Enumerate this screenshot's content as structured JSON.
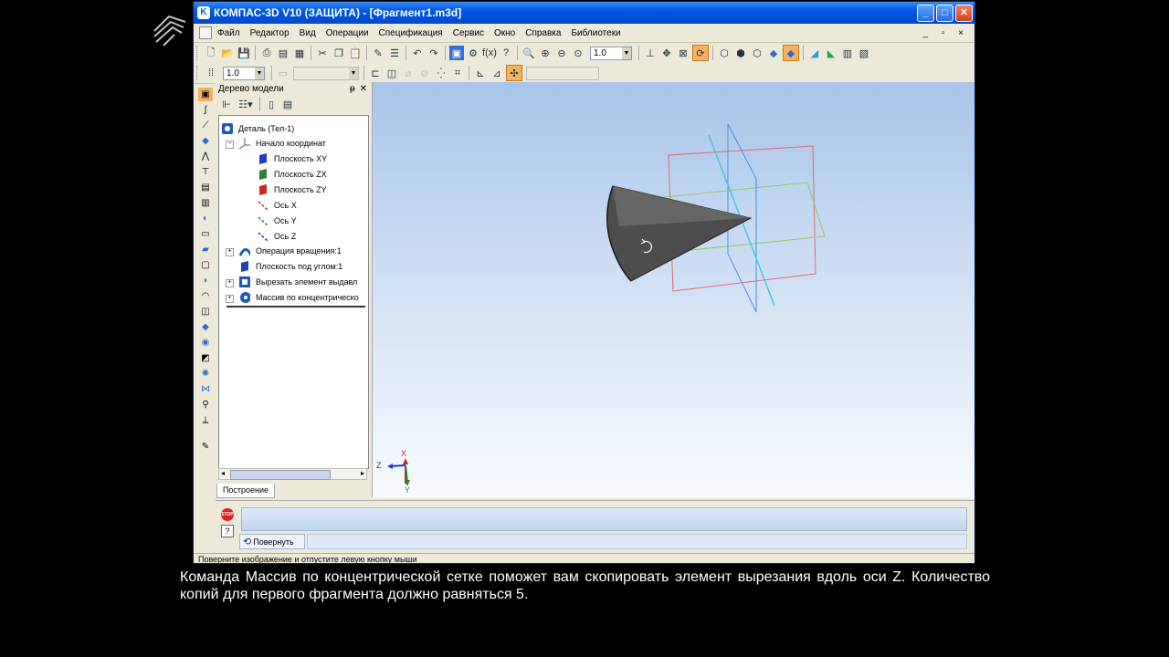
{
  "window": {
    "title": "КОМПАС-3D V10 (ЗАЩИТА) - [Фрагмент1.m3d]",
    "controls": {
      "minimize": "_",
      "maximize": "□",
      "close": "✕"
    }
  },
  "menu": {
    "items": [
      "Файл",
      "Редактор",
      "Вид",
      "Операции",
      "Спецификация",
      "Сервис",
      "Окно",
      "Справка",
      "Библиотеки"
    ],
    "mdi_controls": "_ ▫ ×"
  },
  "toolbar1": {
    "zoom_value": "1.0"
  },
  "toolbar2": {
    "step_value": "1.0"
  },
  "tree": {
    "title": "Дерево модели",
    "pin": "ᵽ",
    "close": "✕",
    "nodes": [
      {
        "label": "Деталь (Тел-1)"
      },
      {
        "label": "Начало координат"
      },
      {
        "label": "Плоскость XY"
      },
      {
        "label": "Плоскость ZX"
      },
      {
        "label": "Плоскость ZY"
      },
      {
        "label": "Ось X"
      },
      {
        "label": "Ось Y"
      },
      {
        "label": "Ось Z"
      },
      {
        "label": "Операция вращения:1"
      },
      {
        "label": "Плоскость под углом:1"
      },
      {
        "label": "Вырезать элемент выдавл"
      },
      {
        "label": "Массив по концентрическо"
      }
    ],
    "tab": "Построение"
  },
  "axes": {
    "x": "X",
    "y": "Y",
    "z": "Z"
  },
  "panel": {
    "stop": "STOP",
    "help": "?",
    "rotate_button": "Повернуть"
  },
  "status": "Поверните изображение и отпустите левую кнопку мыши",
  "caption": "Команда Массив по концентрической сетке поможет вам скопировать элемент вырезания вдоль оси Z. Количество копий для первого фрагмента должно равняться 5.",
  "colors": {
    "title_bar": "#0058e6",
    "viewport_top": "#a8c4e8",
    "viewport_bottom": "#f7fafe",
    "plane_xy": "#1e3cc8",
    "plane_zx": "#2e7d32",
    "plane_zy": "#c62828"
  }
}
